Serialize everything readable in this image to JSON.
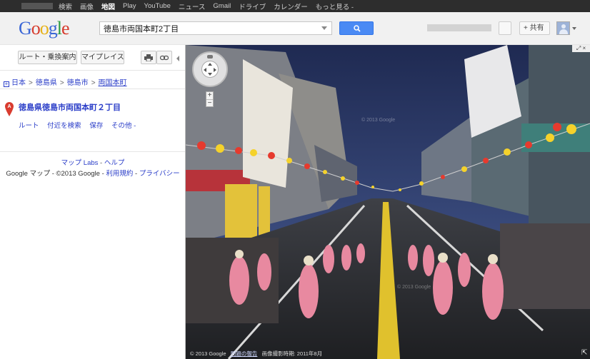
{
  "topbar": {
    "items": [
      "検索",
      "画像",
      "地図",
      "Play",
      "YouTube",
      "ニュース",
      "Gmail",
      "ドライブ",
      "カレンダー",
      "もっと見る -"
    ],
    "active": "地図"
  },
  "header": {
    "logo_letters": [
      "G",
      "o",
      "o",
      "g",
      "l",
      "e"
    ],
    "search_value": "徳島市両国本町2丁目",
    "search_icon": "search-icon",
    "share_label": "+ 共有"
  },
  "left": {
    "route_button": "ルート・乗換案内",
    "myplaces_button": "マイプレイス",
    "print_icon": "print-icon",
    "link_icon": "link-icon",
    "breadcrumb": [
      "日本",
      "徳島県",
      "徳島市",
      "両国本町"
    ],
    "place_title": "徳島県徳島市両国本町２丁目",
    "marker_label": "A",
    "actions": [
      "ルート",
      "付近を検索",
      "保存",
      "その他 -"
    ],
    "labs_link": "マップ Labs",
    "help_link": "ヘルプ",
    "footer_prefix": "Google マップ - ©2013 Google -",
    "terms_link": "利用規約",
    "privacy_link": "プライバシー"
  },
  "streetview": {
    "watermark": "© 2013 Google",
    "footer_copyright": "© 2013 Google",
    "report_link": "問題の報告",
    "capture_date": "画像撮影時期: 2011年8月",
    "zoom_in": "+",
    "zoom_out": "−",
    "expand_label": "⤢ ×"
  },
  "colors": {
    "accent_blue": "#4a8af4",
    "link_blue": "#2a3dc8",
    "marker_red": "#d93c2f"
  }
}
